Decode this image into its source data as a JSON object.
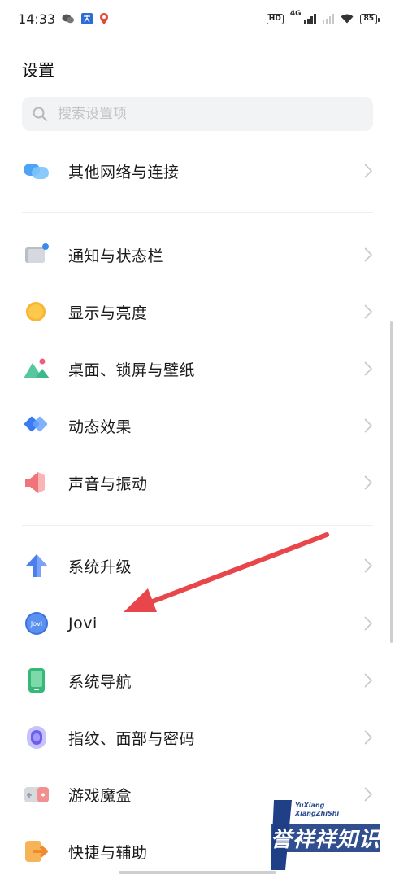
{
  "status_bar": {
    "time": "14:33",
    "hd_label": "HD",
    "network_label": "4G",
    "battery": "85"
  },
  "title": "设置",
  "search": {
    "placeholder": "搜索设置项"
  },
  "items": [
    {
      "label": "其他网络与连接",
      "icon": "network-bubbles-icon"
    },
    {
      "label": "通知与状态栏",
      "icon": "notification-icon"
    },
    {
      "label": "显示与亮度",
      "icon": "brightness-icon"
    },
    {
      "label": "桌面、锁屏与壁纸",
      "icon": "wallpaper-icon"
    },
    {
      "label": "动态效果",
      "icon": "motion-effects-icon"
    },
    {
      "label": "声音与振动",
      "icon": "sound-icon"
    },
    {
      "label": "系统升级",
      "icon": "system-update-icon"
    },
    {
      "label": "Jovi",
      "icon": "jovi-icon",
      "icon_text": "Jovi"
    },
    {
      "label": "系统导航",
      "icon": "system-navigation-icon"
    },
    {
      "label": "指纹、面部与密码",
      "icon": "fingerprint-icon"
    },
    {
      "label": "游戏魔盒",
      "icon": "game-box-icon"
    },
    {
      "label": "快捷与辅助",
      "icon": "shortcut-icon"
    }
  ],
  "colors": {
    "arrow": "#e8464a",
    "accent_blue": "#3a7bf2"
  },
  "watermark": {
    "sub_line1": "YuXiang",
    "sub_line2": "XiangZhiShi",
    "main": "誉祥祥知识"
  }
}
